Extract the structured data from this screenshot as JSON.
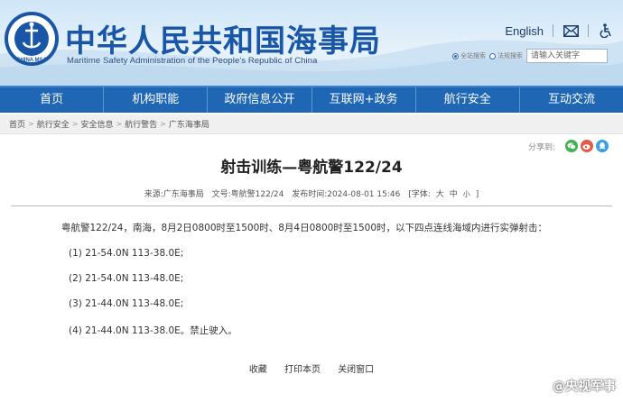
{
  "header": {
    "title": "中华人民共和国海事局",
    "subtitle": "Maritime Safety Administration of the People's Republic of China",
    "logo_text": "CHINA MSA",
    "lang_link": "English",
    "icons": [
      "mail-icon",
      "accessibility-icon"
    ],
    "search": {
      "radio_site": "全站搜索",
      "radio_law": "法规搜索",
      "placeholder": "请输入关键字"
    }
  },
  "nav": {
    "items": [
      "首页",
      "机构职能",
      "政府信息公开",
      "互联网+政务",
      "航行安全",
      "互动交流"
    ]
  },
  "breadcrumb": [
    "首页",
    "航行安全",
    "安全信息",
    "航行警告",
    "广东海事局"
  ],
  "share": {
    "label": "分享到:",
    "icons": [
      "wechat-icon",
      "weibo-icon",
      "qq-icon"
    ],
    "colors": [
      "#3fb34f",
      "#e25b4a",
      "#3aa0e8"
    ]
  },
  "article": {
    "title": "射击训练—粤航警122/24",
    "meta": {
      "source": "来源:广东海事局",
      "doc_no": "文号:粤航警122/24",
      "published": "发布时间:2024-08-01 15:46",
      "font_label": "[字体:",
      "font_large": "大",
      "font_medium": "中",
      "font_small": "小",
      "font_end": "]"
    },
    "intro": "粤航警122/24，南海，8月2日0800时至1500时、8月4日0800时至1500时，以下四点连线海域内进行实弹射击：",
    "coords": [
      "(1)  21-54.0N  113-38.0E;",
      "(2)  21-54.0N  113-48.0E;",
      "(3)  21-44.0N  113-48.0E;",
      "(4)  21-44.0N  113-38.0E。禁止驶入。"
    ]
  },
  "actions": {
    "favorite": "收藏",
    "print": "打印本页",
    "close": "关闭窗口"
  },
  "watermark": "@央视军事",
  "colors": {
    "brand_blue": "#1a56a8",
    "nav_blue": "#1f66b5"
  }
}
